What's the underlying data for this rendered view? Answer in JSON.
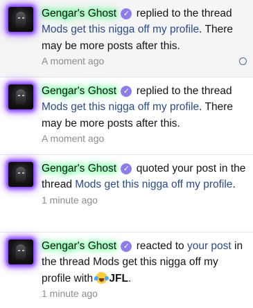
{
  "alerts": [
    {
      "username": "Gengar's Ghost",
      "verified_glyph": "✓",
      "action": "replied to the thread",
      "thread": "Mods get this nigga off my profile",
      "suffix": ". There may be more posts after this.",
      "time": "A moment ago",
      "unread": true,
      "mark_read_icon": "circle-outline-icon"
    },
    {
      "username": "Gengar's Ghost",
      "verified_glyph": "✓",
      "action": "replied to the thread",
      "thread": "Mods get this nigga off my profile",
      "suffix": ". There may be more posts after this.",
      "time": "A moment ago"
    },
    {
      "username": "Gengar's Ghost",
      "verified_glyph": "✓",
      "action": "quoted your post in the thread",
      "thread": "Mods get this nigga off my profile",
      "suffix": ".",
      "time": "1 minute ago"
    },
    {
      "username": "Gengar's Ghost",
      "verified_glyph": "✓",
      "action": "reacted to",
      "post_link": "your post",
      "middle": "in the thread Mods get this nigga off my profile with",
      "reaction_icon": "joy-tears-emoji-icon",
      "reaction_name": "JFL",
      "suffix": ".",
      "time": "1 minute ago"
    }
  ],
  "colors": {
    "link": "#2a4a8c",
    "username_glow": "#3dff7a",
    "avatar_glow": "#7a3cff",
    "verified_badge": "#8d7de8",
    "unread_bg": "#f5f5f5"
  }
}
